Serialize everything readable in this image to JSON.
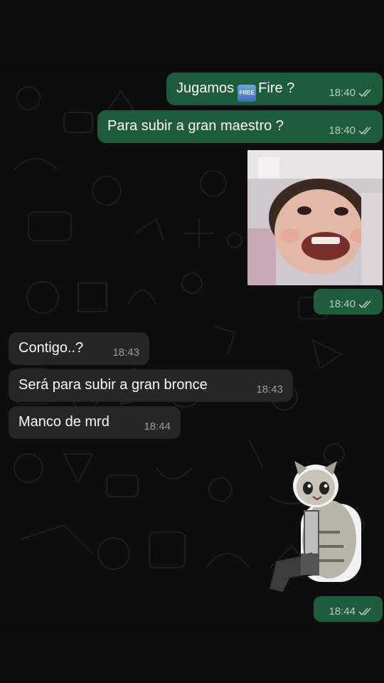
{
  "messages": [
    {
      "dir": "out",
      "text_before": "Jugamos",
      "badge": "FREE",
      "text_after": "Fire ?",
      "time": "18:40"
    },
    {
      "dir": "out",
      "text": "Para subir a gran maestro ?",
      "time": "18:40"
    },
    {
      "dir": "out",
      "kind": "image",
      "time": "18:40"
    },
    {
      "dir": "in",
      "text": "Contigo..?",
      "time": "18:43"
    },
    {
      "dir": "in",
      "text": "Será para subir a gran bronce",
      "time": "18:43"
    },
    {
      "dir": "in",
      "text": "Manco de mrd",
      "time": "18:44"
    },
    {
      "dir": "out",
      "kind": "sticker",
      "time": "18:44"
    }
  ],
  "icons": {
    "read_receipt": "double-check-icon",
    "free_emoji": "free-button-emoji"
  },
  "colors": {
    "outgoing": "#1e5c3b",
    "incoming": "#262626",
    "background": "#0d0d0d",
    "text": "#ffffff"
  }
}
